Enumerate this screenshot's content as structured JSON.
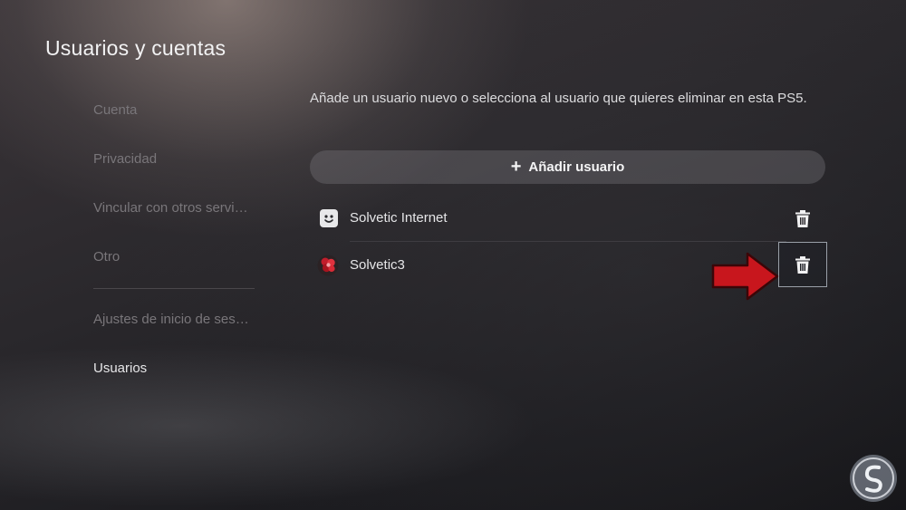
{
  "page_title": "Usuarios y cuentas",
  "sidebar": {
    "items": [
      {
        "label": "Cuenta",
        "active": false
      },
      {
        "label": "Privacidad",
        "active": false
      },
      {
        "label": "Vincular con otros servi…",
        "active": false
      },
      {
        "label": "Otro",
        "active": false
      },
      {
        "label": "Ajustes de inicio de ses…",
        "active": false
      },
      {
        "label": "Usuarios",
        "active": true
      }
    ]
  },
  "main": {
    "description": "Añade un usuario nuevo o selecciona al usuario que quieres eliminar en esta PS5.",
    "add_user_label": "Añadir usuario",
    "add_user_icon": "plus-icon",
    "users": [
      {
        "name": "Solvetic Internet",
        "avatar": "smiley-avatar-icon",
        "action_icon": "trash-icon",
        "focused": false
      },
      {
        "name": "Solvetic3",
        "avatar": "red-flower-avatar-icon",
        "action_icon": "trash-icon",
        "focused": true
      }
    ]
  },
  "annotation": {
    "arrow_icon": "red-arrow-icon",
    "color": "#c8161d"
  },
  "colors": {
    "accent_arrow": "#c8161d",
    "background": "#1b1b1f",
    "text": "#e9e9ea",
    "muted_text": "#79767a"
  }
}
